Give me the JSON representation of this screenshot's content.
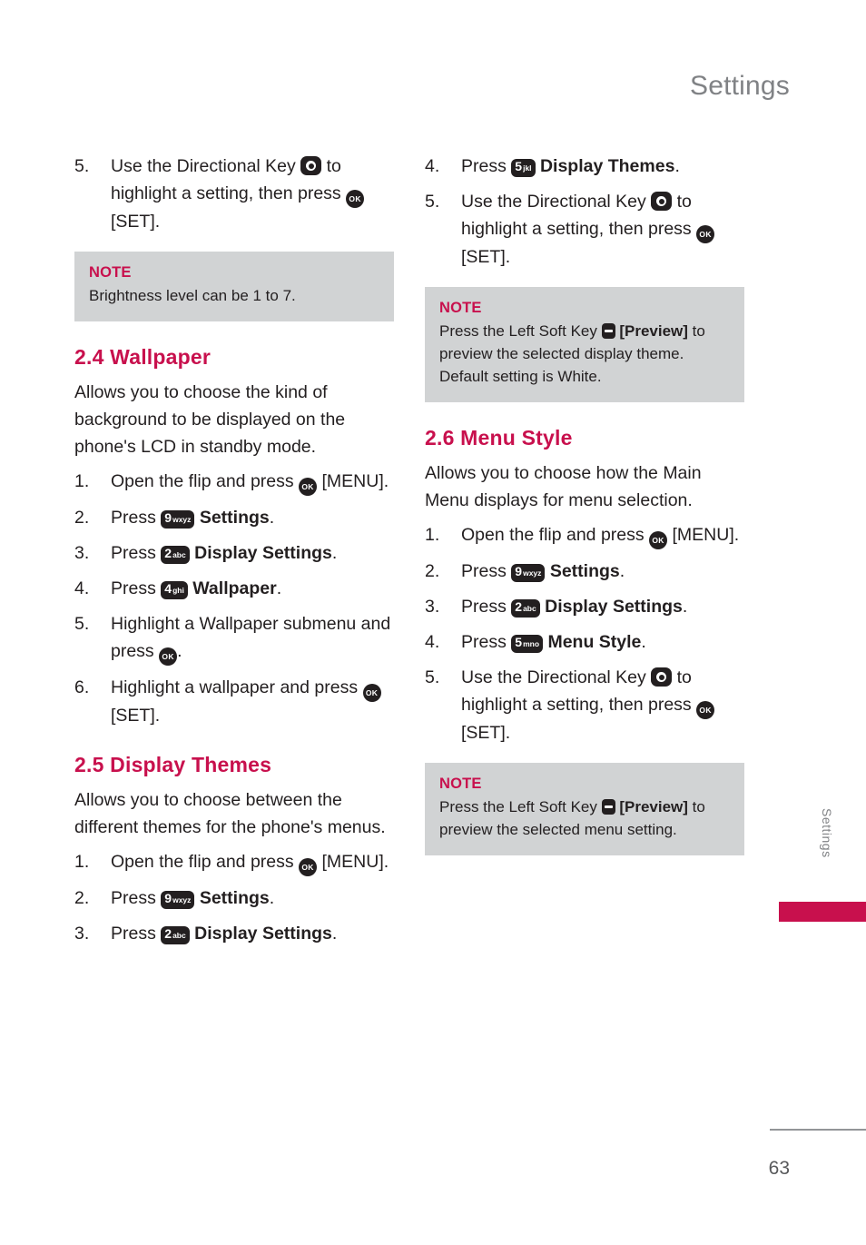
{
  "header": {
    "title": "Settings"
  },
  "side_tab": {
    "label": "Settings"
  },
  "footer": {
    "page_number": "63"
  },
  "left_column": {
    "top_steps": [
      {
        "num": "5.",
        "text_before": "Use the Directional Key",
        "key": "directional-key",
        "text_mid": "to highlight a setting, then press",
        "key2": "ok-key",
        "text_after": "[SET]."
      }
    ],
    "note1": {
      "title": "NOTE",
      "body": "Brightness level can be 1 to 7."
    },
    "section_wallpaper": {
      "heading": "2.4 Wallpaper",
      "intro": "Allows you to choose the kind of background to be displayed on the phone's LCD in standby mode.",
      "steps": [
        {
          "num": "1.",
          "before": "Open the flip and press",
          "key": "ok-key",
          "after": "[MENU]."
        },
        {
          "num": "2.",
          "before": "Press",
          "key": "9wxyz",
          "after": "Settings.",
          "after_bold": "Settings"
        },
        {
          "num": "3.",
          "before": "Press",
          "key": "2abc",
          "after": "Display Settings.",
          "after_bold": "Display Settings"
        },
        {
          "num": "4.",
          "before": "Press",
          "key": "4ghi",
          "after": "Wallpaper.",
          "after_bold": "Wallpaper"
        },
        {
          "num": "5.",
          "before": "Highlight a Wallpaper submenu and press",
          "key": "ok-key",
          "after": "."
        },
        {
          "num": "6.",
          "before": "Highlight a wallpaper and press",
          "key": "ok-key",
          "after": "[SET]."
        }
      ]
    },
    "section_display_themes": {
      "heading": "2.5 Display Themes",
      "intro": "Allows you to choose between the different themes for the phone's menus.",
      "steps": [
        {
          "num": "1.",
          "before": "Open the flip and press",
          "key": "ok-key",
          "after": "[MENU]."
        },
        {
          "num": "2.",
          "before": "Press",
          "key": "9wxyz",
          "after": "Settings.",
          "after_bold": "Settings"
        },
        {
          "num": "3.",
          "before": "Press",
          "key": "2abc",
          "after": "Display Settings.",
          "after_bold": "Display Settings"
        }
      ]
    }
  },
  "right_column": {
    "top_steps": [
      {
        "num": "4.",
        "before": "Press",
        "key": "5jkl",
        "after": "Display Themes.",
        "after_bold": "Display Themes"
      },
      {
        "num": "5.",
        "before": "Use the Directional Key",
        "key": "directional-key",
        "mid": "to highlight a setting, then press",
        "key2": "ok-key",
        "after": "[SET]."
      }
    ],
    "note1": {
      "title": "NOTE",
      "body_before": "Press the Left Soft Key",
      "body_key": "left-soft-key",
      "body_bold": "[Preview]",
      "body_after": "to preview the selected display theme. Default setting is White."
    },
    "section_menu_style": {
      "heading": "2.6 Menu Style",
      "intro": "Allows you to choose how the Main Menu displays for menu selection.",
      "steps": [
        {
          "num": "1.",
          "before": "Open the flip and press",
          "key": "ok-key",
          "after": "[MENU]."
        },
        {
          "num": "2.",
          "before": "Press",
          "key": "9wxyz",
          "after": "Settings.",
          "after_bold": "Settings"
        },
        {
          "num": "3.",
          "before": "Press",
          "key": "2abc",
          "after": "Display Settings.",
          "after_bold": "Display Settings"
        },
        {
          "num": "4.",
          "before": "Press",
          "key": "5mno",
          "after": "Menu Style.",
          "after_bold": "Menu Style"
        },
        {
          "num": "5.",
          "before": "Use the Directional Key",
          "key": "directional-key",
          "mid": "to highlight a setting, then press",
          "key2": "ok-key",
          "after": "[SET]."
        }
      ]
    },
    "note2": {
      "title": "NOTE",
      "body_before": "Press the Left Soft Key",
      "body_key": "left-soft-key",
      "body_bold": "[Preview]",
      "body_after": "to preview the selected menu setting."
    }
  },
  "keycaps": {
    "ok": "OK",
    "k9": {
      "big": "9",
      "sub": "wxyz"
    },
    "k2": {
      "big": "2",
      "sub": "abc"
    },
    "k4": {
      "big": "4",
      "sub": "ghi"
    },
    "k5jkl": {
      "big": "5",
      "sub": "jkl"
    },
    "k5mno": {
      "big": "5",
      "sub": "mno"
    }
  }
}
